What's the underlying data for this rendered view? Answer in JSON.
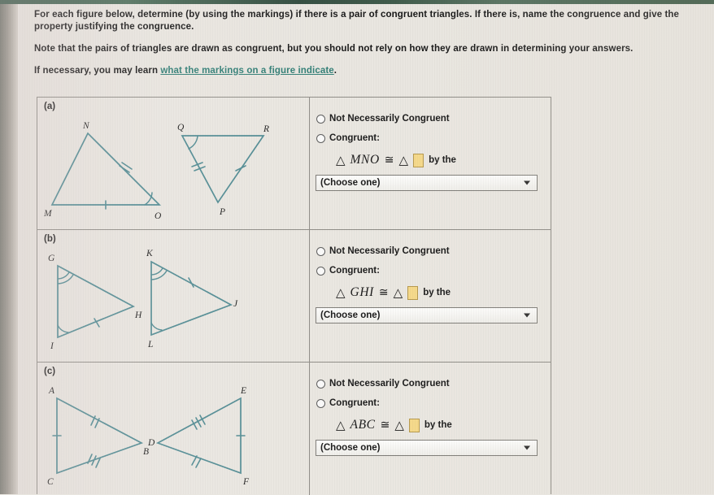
{
  "instructions": {
    "paragraph1": "For each figure below, determine (by using the markings) if there is a pair of congruent triangles. If there is, name the congruence and give the property justifying the congruence.",
    "paragraph2": "Note that the pairs of triangles are drawn as congruent, but you should not rely on how they are drawn in determining your answers.",
    "paragraph3_prefix": "If necessary, you may learn ",
    "paragraph3_link": "what the markings on a figure indicate",
    "paragraph3_suffix": "."
  },
  "colors": {
    "figure_stroke": "#4e8a92",
    "link": "#2e7d74",
    "input_highlight": "#f5d98a",
    "page_background": "#e9e6e0"
  },
  "options": {
    "not_congruent_label": "Not Necessarily Congruent",
    "congruent_label": "Congruent:",
    "by_the_label": "by the",
    "select_value": "(Choose one)",
    "congruent_symbol": "≅",
    "triangle_symbol": "△"
  },
  "parts": [
    {
      "label": "(a)",
      "given_triangle": "MNO",
      "figure": {
        "left_triangle": {
          "vertices": [
            "M",
            "N",
            "O"
          ],
          "angle_arcs": [
            {
              "at": "O",
              "count": 1
            }
          ],
          "ticks": [
            {
              "side": "NO",
              "count": 2
            },
            {
              "side": "MO",
              "count": 1
            }
          ]
        },
        "right_triangle": {
          "vertices": [
            "Q",
            "R",
            "P"
          ],
          "angle_arcs": [
            {
              "at": "Q",
              "count": 1
            }
          ],
          "ticks": [
            {
              "side": "QP",
              "count": 2
            },
            {
              "side": "PR",
              "count": 1
            }
          ]
        }
      }
    },
    {
      "label": "(b)",
      "given_triangle": "GHI",
      "figure": {
        "left_triangle": {
          "vertices": [
            "G",
            "H",
            "I"
          ],
          "angle_arcs": [
            {
              "at": "G",
              "count": 2
            },
            {
              "at": "I",
              "count": 1
            }
          ],
          "ticks": [
            {
              "side": "IH",
              "count": 1
            }
          ]
        },
        "right_triangle": {
          "vertices": [
            "K",
            "J",
            "L"
          ],
          "angle_arcs": [
            {
              "at": "K",
              "count": 2
            },
            {
              "at": "L",
              "count": 1
            }
          ],
          "ticks": [
            {
              "side": "KJ",
              "count": 1
            }
          ]
        }
      }
    },
    {
      "label": "(c)",
      "given_triangle": "ABC",
      "figure": {
        "left_triangle": {
          "vertices": [
            "A",
            "B",
            "C"
          ],
          "angle_arcs": [],
          "ticks": [
            {
              "side": "AC",
              "count": 1
            },
            {
              "side": "AB",
              "count": 2
            },
            {
              "side": "BC",
              "count": 3
            }
          ]
        },
        "right_triangle": {
          "vertices": [
            "D",
            "E",
            "F"
          ],
          "angle_arcs": [],
          "ticks": [
            {
              "side": "EF",
              "count": 1
            },
            {
              "side": "DF",
              "count": 2
            },
            {
              "side": "DE",
              "count": 3
            }
          ]
        }
      }
    }
  ]
}
